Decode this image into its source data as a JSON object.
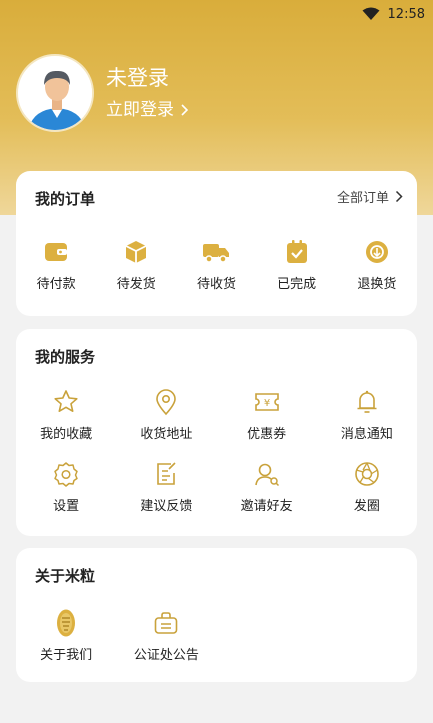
{
  "status_bar": {
    "time": "12:58"
  },
  "profile": {
    "name": "未登录",
    "login_link": "立即登录",
    "avatar_icon": "user-avatar"
  },
  "orders": {
    "title": "我的订单",
    "all_orders_label": "全部订单",
    "items": [
      {
        "label": "待付款",
        "icon": "wallet-icon"
      },
      {
        "label": "待发货",
        "icon": "box-icon"
      },
      {
        "label": "待收货",
        "icon": "truck-icon"
      },
      {
        "label": "已完成",
        "icon": "check-box-icon"
      },
      {
        "label": "退换货",
        "icon": "return-icon"
      }
    ]
  },
  "services": {
    "title": "我的服务",
    "items": [
      {
        "label": "我的收藏",
        "icon": "star-icon"
      },
      {
        "label": "收货地址",
        "icon": "location-pin-icon"
      },
      {
        "label": "优惠券",
        "icon": "coupon-icon"
      },
      {
        "label": "消息通知",
        "icon": "bell-icon"
      },
      {
        "label": "设置",
        "icon": "gear-icon"
      },
      {
        "label": "建议反馈",
        "icon": "feedback-icon"
      },
      {
        "label": "邀请好友",
        "icon": "invite-friend-icon"
      },
      {
        "label": "发圈",
        "icon": "shutter-icon"
      }
    ]
  },
  "about": {
    "title": "关于米粒",
    "items": [
      {
        "label": "关于我们",
        "icon": "rice-grain-logo-icon"
      },
      {
        "label": "公证处公告",
        "icon": "notice-bag-icon"
      }
    ]
  },
  "colors": {
    "accent": "#dcb040",
    "header_top": "#d9ad3b",
    "background": "#f2f2f2",
    "icon_outline": "#c9a23b"
  }
}
